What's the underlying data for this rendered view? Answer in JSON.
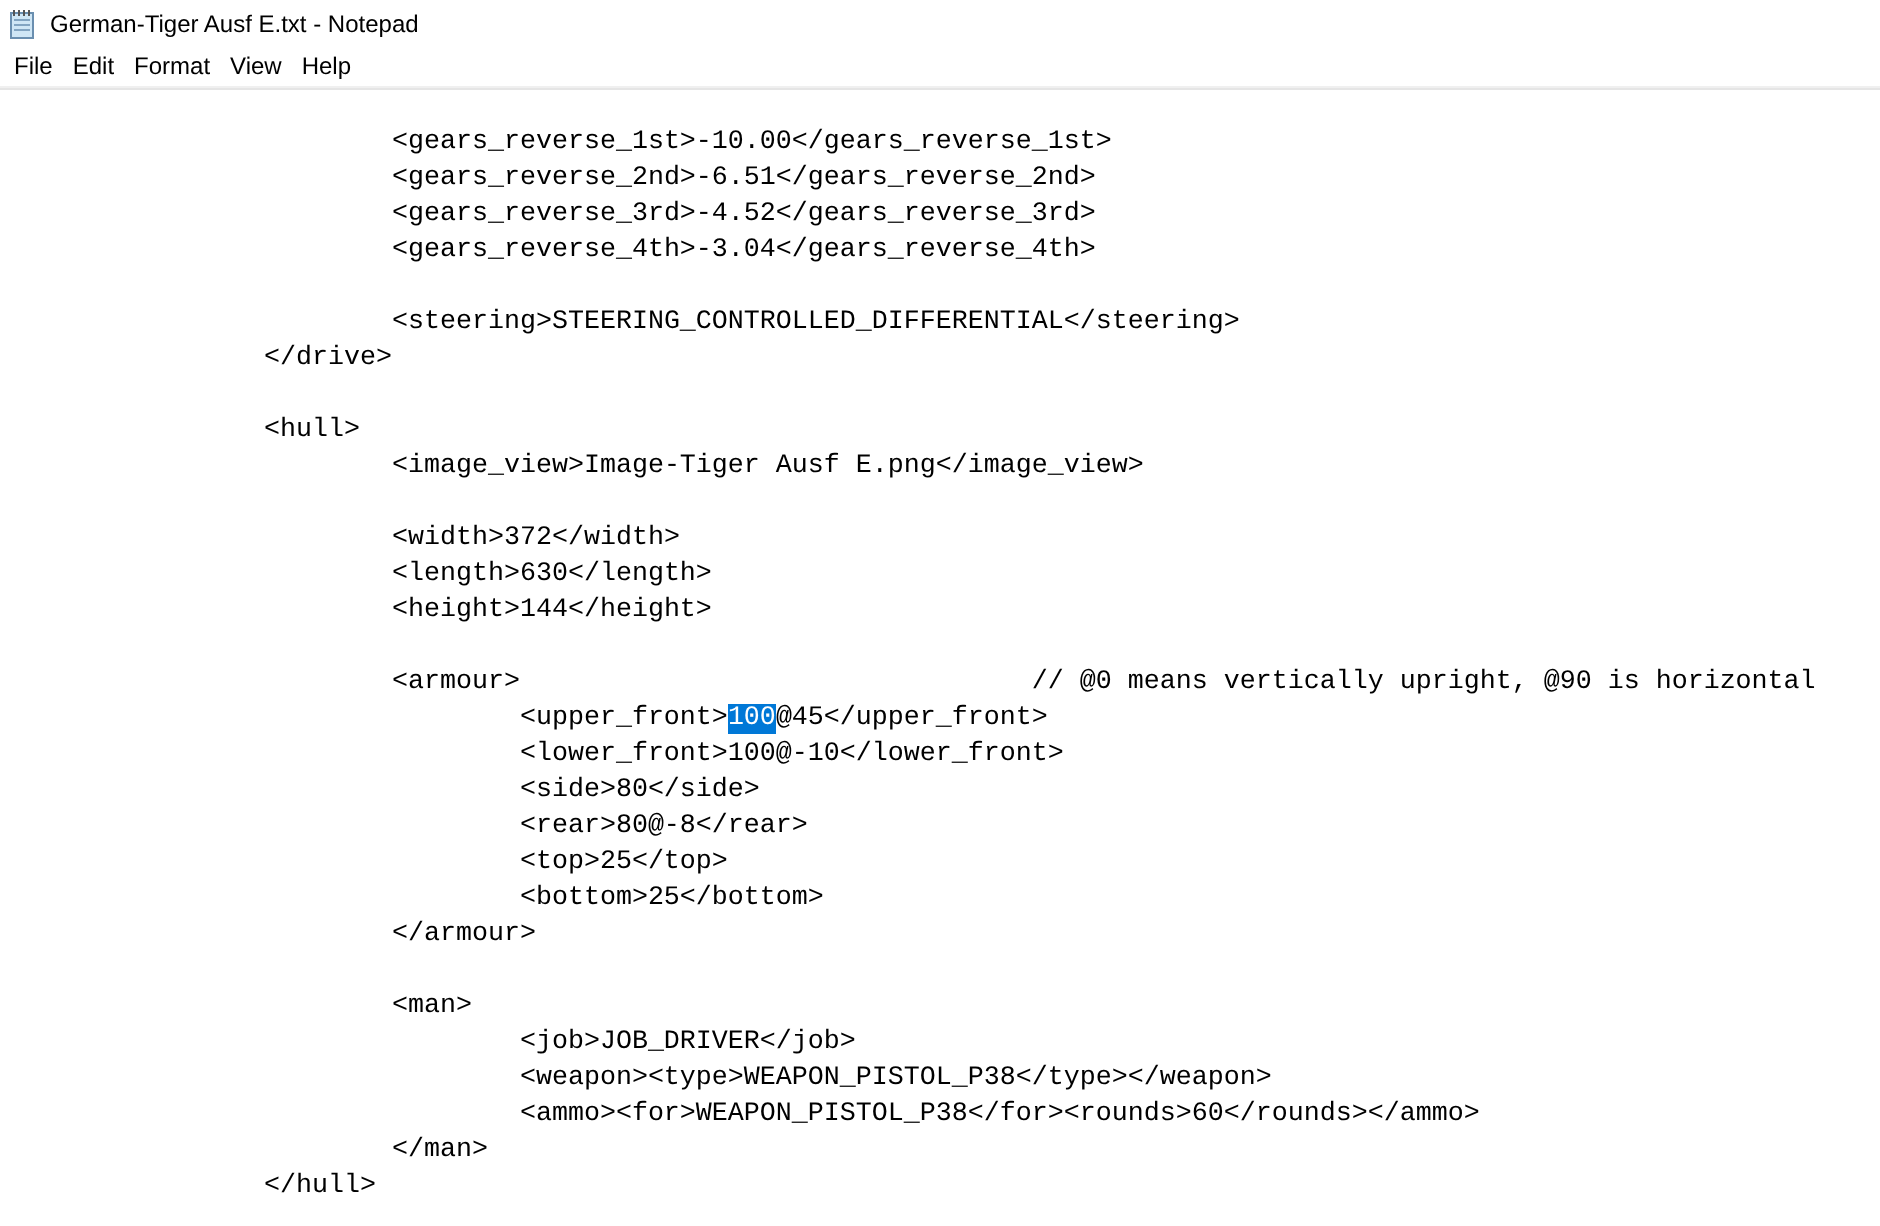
{
  "window": {
    "title": "German-Tiger Ausf E.txt - Notepad"
  },
  "menu": [
    "File",
    "Edit",
    "Format",
    "View",
    "Help"
  ],
  "lines": [
    {
      "kind": "blank"
    },
    {
      "kind": "text",
      "text": "\t\t\t<gears_reverse_1st>-10.00</gears_reverse_1st>"
    },
    {
      "kind": "text",
      "text": "\t\t\t<gears_reverse_2nd>-6.51</gears_reverse_2nd>"
    },
    {
      "kind": "text",
      "text": "\t\t\t<gears_reverse_3rd>-4.52</gears_reverse_3rd>"
    },
    {
      "kind": "text",
      "text": "\t\t\t<gears_reverse_4th>-3.04</gears_reverse_4th>"
    },
    {
      "kind": "blank"
    },
    {
      "kind": "text",
      "text": "\t\t\t<steering>STEERING_CONTROLLED_DIFFERENTIAL</steering>"
    },
    {
      "kind": "text",
      "text": "\t\t</drive>"
    },
    {
      "kind": "blank"
    },
    {
      "kind": "text",
      "text": "\t\t<hull>"
    },
    {
      "kind": "text",
      "text": "\t\t\t<image_view>Image-Tiger Ausf E.png</image_view>"
    },
    {
      "kind": "blank"
    },
    {
      "kind": "text",
      "text": "\t\t\t<width>372</width>"
    },
    {
      "kind": "text",
      "text": "\t\t\t<length>630</length>"
    },
    {
      "kind": "text",
      "text": "\t\t\t<height>144</height>"
    },
    {
      "kind": "blank"
    },
    {
      "kind": "text",
      "text": "\t\t\t<armour>\t\t\t\t// @0 means vertically upright, @90 is horizontal"
    },
    {
      "kind": "selection",
      "text": "\t\t\t\t<upper_front>",
      "selected_text": "100",
      "text_after": "@45</upper_front>"
    },
    {
      "kind": "text",
      "text": "\t\t\t\t<lower_front>100@-10</lower_front>"
    },
    {
      "kind": "text",
      "text": "\t\t\t\t<side>80</side>"
    },
    {
      "kind": "text",
      "text": "\t\t\t\t<rear>80@-8</rear>"
    },
    {
      "kind": "text",
      "text": "\t\t\t\t<top>25</top>"
    },
    {
      "kind": "text",
      "text": "\t\t\t\t<bottom>25</bottom>"
    },
    {
      "kind": "text",
      "text": "\t\t\t</armour>"
    },
    {
      "kind": "blank"
    },
    {
      "kind": "text",
      "text": "\t\t\t<man>"
    },
    {
      "kind": "text",
      "text": "\t\t\t\t<job>JOB_DRIVER</job>"
    },
    {
      "kind": "text",
      "text": "\t\t\t\t<weapon><type>WEAPON_PISTOL_P38</type></weapon>"
    },
    {
      "kind": "text",
      "text": "\t\t\t\t<ammo><for>WEAPON_PISTOL_P38</for><rounds>60</rounds></ammo>"
    },
    {
      "kind": "text",
      "text": "\t\t\t</man>"
    },
    {
      "kind": "text",
      "text": "\t\t</hull>"
    }
  ]
}
